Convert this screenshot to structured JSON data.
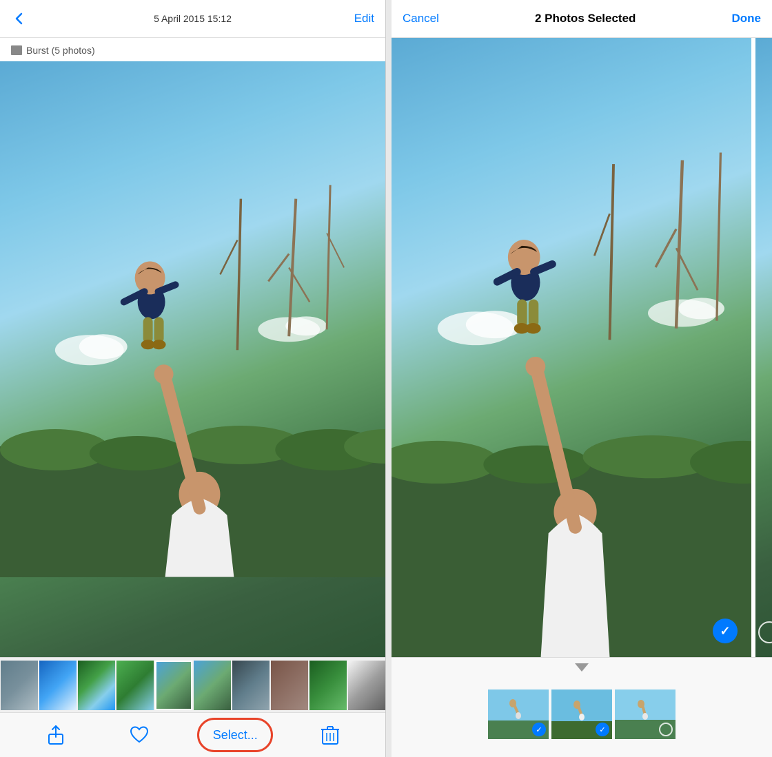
{
  "left": {
    "header": {
      "back_label": "‹",
      "date_label": "5 April 2015  15:12",
      "edit_label": "Edit"
    },
    "burst_label": "Burst (5 photos)",
    "toolbar": {
      "select_label": "Select...",
      "share_label": "Share",
      "heart_label": "♡",
      "trash_label": "🗑"
    }
  },
  "right": {
    "header": {
      "cancel_label": "Cancel",
      "title": "2 Photos Selected",
      "done_label": "Done"
    }
  },
  "colors": {
    "accent": "#007AFF",
    "circle_color": "#e8442a"
  }
}
